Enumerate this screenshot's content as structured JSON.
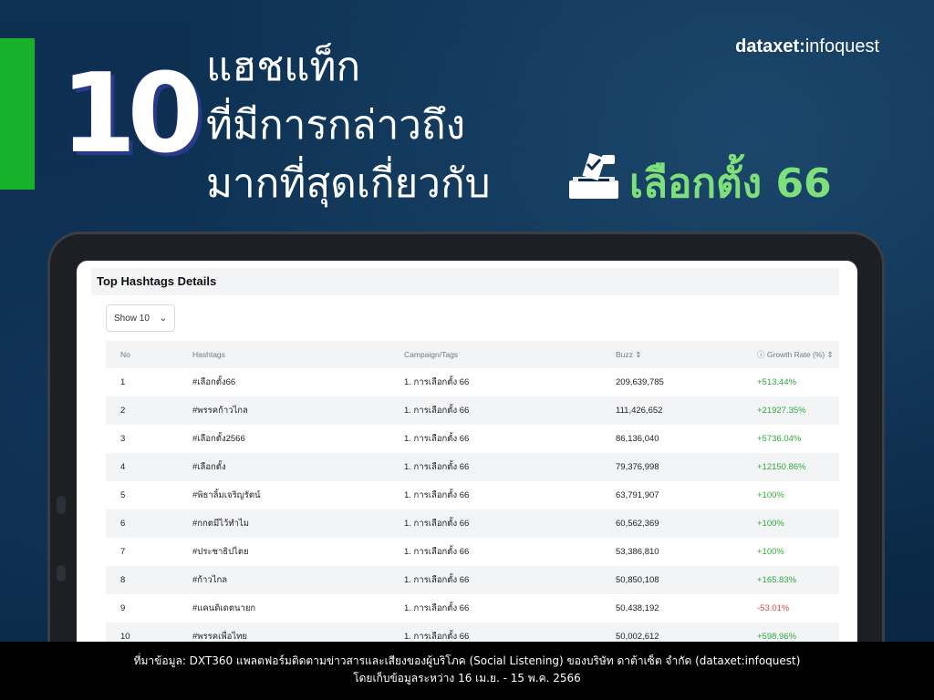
{
  "brand": {
    "data": "dataxet",
    "sep": ":",
    "name": "infoquest"
  },
  "headline": {
    "number": "10",
    "line1": "แฮชแท็ก",
    "line2": "ที่มีการกล่าวถึง",
    "line3": "มากที่สุดเกี่ยวกับ",
    "highlight": "เลือกตั้ง 66"
  },
  "panel": {
    "title": "Top Hashtags Details",
    "show_select": "Show 10",
    "columns": {
      "no": "No",
      "hashtags": "Hashtags",
      "campaign": "Campaign/Tags",
      "buzz": "Buzz ⇕",
      "growth": "Growth Rate (%) ⇕"
    },
    "rows": [
      {
        "no": "1",
        "hashtag": "#เลือกตั้ง66",
        "campaign": "1. การเลือกตั้ง 66",
        "buzz": "209,639,785",
        "growth": "+513.44%",
        "trend": "pos"
      },
      {
        "no": "2",
        "hashtag": "#พรรคก้าวไกล",
        "campaign": "1. การเลือกตั้ง 66",
        "buzz": "111,426,652",
        "growth": "+21927.35%",
        "trend": "pos"
      },
      {
        "no": "3",
        "hashtag": "#เลือกตั้ง2566",
        "campaign": "1. การเลือกตั้ง 66",
        "buzz": "86,136,040",
        "growth": "+5736.04%",
        "trend": "pos"
      },
      {
        "no": "4",
        "hashtag": "#เลือกตั้ง",
        "campaign": "1. การเลือกตั้ง 66",
        "buzz": "79,376,998",
        "growth": "+12150.86%",
        "trend": "pos"
      },
      {
        "no": "5",
        "hashtag": "#พิธาลิ้มเจริญรัตน์",
        "campaign": "1. การเลือกตั้ง 66",
        "buzz": "63,791,907",
        "growth": "+100%",
        "trend": "pos"
      },
      {
        "no": "6",
        "hashtag": "#กกตมีไว้ทำไม",
        "campaign": "1. การเลือกตั้ง 66",
        "buzz": "60,562,369",
        "growth": "+100%",
        "trend": "pos"
      },
      {
        "no": "7",
        "hashtag": "#ประชาธิปไตย",
        "campaign": "1. การเลือกตั้ง 66",
        "buzz": "53,386,810",
        "growth": "+100%",
        "trend": "pos"
      },
      {
        "no": "8",
        "hashtag": "#ก้าวไกล",
        "campaign": "1. การเลือกตั้ง 66",
        "buzz": "50,850,108",
        "growth": "+165.83%",
        "trend": "pos"
      },
      {
        "no": "9",
        "hashtag": "#แคนดิเดตนายก",
        "campaign": "1. การเลือกตั้ง 66",
        "buzz": "50,438,192",
        "growth": "-53.01%",
        "trend": "neg"
      },
      {
        "no": "10",
        "hashtag": "#พรรคเพื่อไทย",
        "campaign": "1. การเลือกตั้ง 66",
        "buzz": "50,002,612",
        "growth": "+598.96%",
        "trend": "pos"
      }
    ]
  },
  "footer": {
    "line1": "ที่มาข้อมูล: DXT360 แพลตฟอร์มติดตามข่าวสารและเสียงของผู้บริโภค (Social Listening) ของบริษัท ดาต้าเซ็ต จำกัด (dataxet:infoquest)",
    "line2": "โดยเก็บข้อมูลระหว่าง 16 เม.ย. - 15 พ.ค. 2566"
  },
  "colors": {
    "green_accent": "#18b12b",
    "highlight": "#7ee07a",
    "positive": "#2eaa3a",
    "negative": "#e04848",
    "background": "#0b2a4a"
  },
  "icons": {
    "ballot": "ballot-box-icon",
    "info": "info-icon",
    "chevron": "chevron-down-icon"
  }
}
